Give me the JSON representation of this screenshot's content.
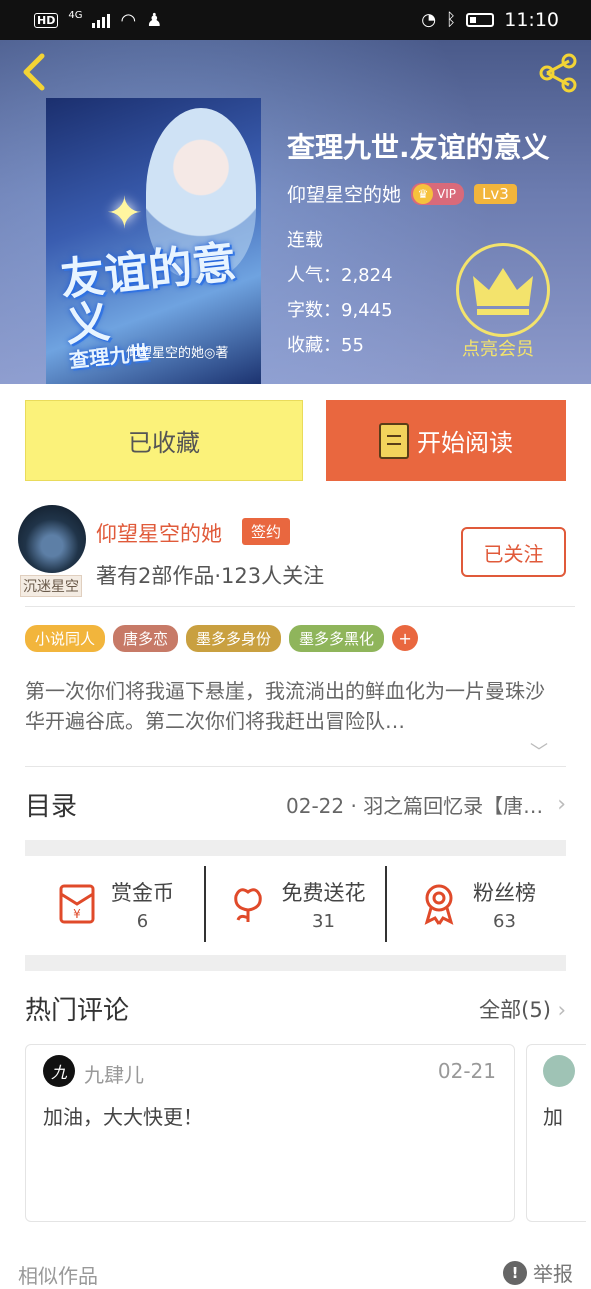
{
  "status": {
    "hd": "HD",
    "network": "4G",
    "time": "11:10"
  },
  "book": {
    "title": "查理九世.友谊的意义",
    "cover_title": "友谊的意义",
    "cover_subtitle": "查理九世",
    "cover_author": "仰望星空的她◎著",
    "author": "仰望星空的她",
    "vip": "VIP",
    "level": "Lv3",
    "status": "连载",
    "popularity": "人气：2,824",
    "words": "字数：9,445",
    "favorites": "收藏：55",
    "member_label": "点亮会员"
  },
  "actions": {
    "favorited": "已收藏",
    "start_reading": "开始阅读"
  },
  "writer": {
    "avatar_tag": "沉迷星空",
    "name": "仰望星空的她",
    "badge": "签约",
    "stats": "著有2部作品·123人关注",
    "follow": "已关注"
  },
  "tags": [
    {
      "label": "小说同人",
      "color": "#f2b53c"
    },
    {
      "label": "唐多恋",
      "color": "#c77a67"
    },
    {
      "label": "墨多多身份",
      "color": "#c9a040"
    },
    {
      "label": "墨多多黑化",
      "color": "#8fb55b"
    }
  ],
  "tag_add": "+",
  "intro": "第一次你们将我逼下悬崖，我流淌出的鲜血化为一片曼珠沙华开遍谷底。第二次你们将我赶出冒险队…",
  "toc": {
    "label": "目录",
    "latest": "02-22 · 羽之篇回忆录【唐…"
  },
  "stats": [
    {
      "label": "赏金币",
      "value": "6",
      "icon": "red-envelope-icon"
    },
    {
      "label": "免费送花",
      "value": "31",
      "icon": "flower-icon"
    },
    {
      "label": "粉丝榜",
      "value": "63",
      "icon": "medal-icon"
    }
  ],
  "comments_section": {
    "title": "热门评论",
    "all": "全部(5)"
  },
  "comment": {
    "avatar": "九",
    "name": "九肆儿",
    "date": "02-21",
    "text": "加油，大大快更！"
  },
  "comment2": {
    "text": "加"
  },
  "bottom": {
    "left": "相似作品",
    "right": "举报"
  }
}
